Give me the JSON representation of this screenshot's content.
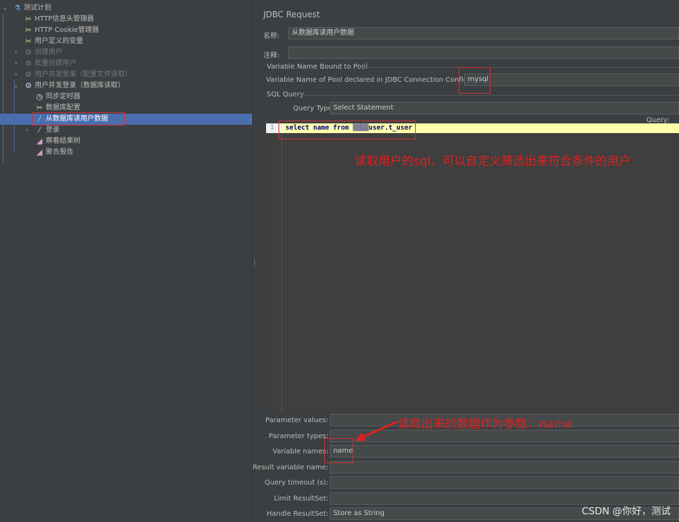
{
  "tree": {
    "items": [
      {
        "label": "测试计划",
        "icon": "test-plan-icon",
        "level": 0,
        "expander": "expanded"
      },
      {
        "label": "HTTP信息头管理器",
        "icon": "config-element-icon",
        "level": 1
      },
      {
        "label": "HTTP Cookie管理器",
        "icon": "config-element-icon",
        "level": 1
      },
      {
        "label": "用户定义的变量",
        "icon": "config-element-icon",
        "level": 1
      },
      {
        "label": "创建用户",
        "icon": "thread-group-icon",
        "level": 1,
        "expander": "collapsed",
        "disabled": true
      },
      {
        "label": "批量创建用户",
        "icon": "thread-group-icon",
        "level": 1,
        "expander": "collapsed",
        "disabled": true
      },
      {
        "label": "用户并发登录（配置文件读取）",
        "icon": "thread-group-icon",
        "level": 1,
        "expander": "collapsed",
        "disabled": true
      },
      {
        "label": "用户并发登录（数据库读取）",
        "icon": "thread-group-icon",
        "level": 1,
        "expander": "expanded"
      },
      {
        "label": "同步定时器",
        "icon": "timer-icon",
        "level": 2
      },
      {
        "label": "数据库配置",
        "icon": "config-element-icon",
        "level": 2
      },
      {
        "label": "从数据库读用户数据",
        "icon": "sampler-icon",
        "level": 2,
        "selected": true
      },
      {
        "label": "登录",
        "icon": "sampler-icon",
        "level": 2,
        "expander": "collapsed"
      },
      {
        "label": "察看结果树",
        "icon": "listener-icon",
        "level": 2
      },
      {
        "label": "聚合报告",
        "icon": "listener-icon",
        "level": 2
      }
    ]
  },
  "main": {
    "title": "JDBC Request",
    "name_label": "名称:",
    "name_value": "从数据库读用户数据",
    "comment_label": "注释:",
    "comment_value": "",
    "pool_section": "Variable Name Bound to Pool",
    "pool_label": "Variable Name of Pool declared in JDBC Connection Configuration:",
    "pool_value": "mysql",
    "sql_section": "SQL Query",
    "query_type_label": "Query Type:",
    "query_type_value": "Select Statement",
    "query_header": "Query:",
    "line_number": "1",
    "sql": "select name from ▒▒▒▒user.t_user",
    "params": [
      {
        "label": "Parameter values:",
        "value": ""
      },
      {
        "label": "Parameter types:",
        "value": ""
      },
      {
        "label": "Variable names:",
        "value": "name"
      },
      {
        "label": "Result variable name:",
        "value": ""
      },
      {
        "label": "Query timeout (s):",
        "value": ""
      },
      {
        "label": "Limit ResultSet:",
        "value": ""
      },
      {
        "label": "Handle ResultSet:",
        "value": "Store as String"
      }
    ]
  },
  "annotations": {
    "sql_note": "读取用户的sql，可以自定义筛选出来符合条件的用户",
    "param_note": "读取出来的数据作为参数：name"
  },
  "watermark": "CSDN @你好，测试",
  "colors": {
    "selection": "#4b6eaf",
    "annotation": "#e02020",
    "editor_line": "#ffffaa"
  }
}
